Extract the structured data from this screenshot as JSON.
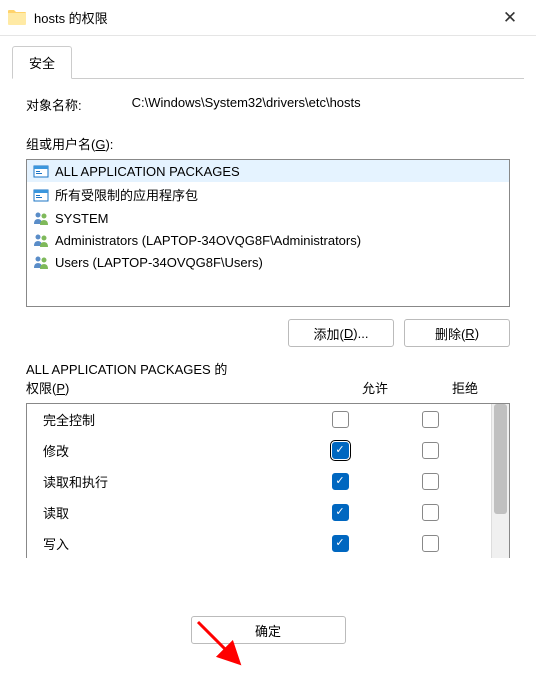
{
  "window": {
    "title": "hosts 的权限"
  },
  "tab": {
    "label": "安全"
  },
  "object": {
    "label": "对象名称:",
    "path": "C:\\Windows\\System32\\drivers\\etc\\hosts"
  },
  "groups": {
    "label_prefix": "组或用户名(",
    "label_key": "G",
    "label_suffix": "):",
    "items": [
      {
        "name": "ALL APPLICATION PACKAGES",
        "icon": "package",
        "selected": true
      },
      {
        "name": "所有受限制的应用程序包",
        "icon": "package",
        "selected": false
      },
      {
        "name": "SYSTEM",
        "icon": "users",
        "selected": false
      },
      {
        "name": "Administrators (LAPTOP-34OVQG8F\\Administrators)",
        "icon": "users",
        "selected": false
      },
      {
        "name": "Users (LAPTOP-34OVQG8F\\Users)",
        "icon": "users",
        "selected": false
      }
    ]
  },
  "buttons": {
    "add_prefix": "添加(",
    "add_key": "D",
    "add_suffix": ")...",
    "remove_prefix": "删除(",
    "remove_key": "R",
    "remove_suffix": ")",
    "ok": "确定"
  },
  "permissions": {
    "title_line1": "ALL APPLICATION PACKAGES 的",
    "title_line2_prefix": "权限(",
    "title_line2_key": "P",
    "title_line2_suffix": ")",
    "allow_header": "允许",
    "deny_header": "拒绝",
    "rows": [
      {
        "name": "完全控制",
        "allow": false,
        "deny": false,
        "focused": false
      },
      {
        "name": "修改",
        "allow": true,
        "deny": false,
        "focused": true
      },
      {
        "name": "读取和执行",
        "allow": true,
        "deny": false,
        "focused": false
      },
      {
        "name": "读取",
        "allow": true,
        "deny": false,
        "focused": false
      },
      {
        "name": "写入",
        "allow": true,
        "deny": false,
        "focused": false
      }
    ]
  }
}
